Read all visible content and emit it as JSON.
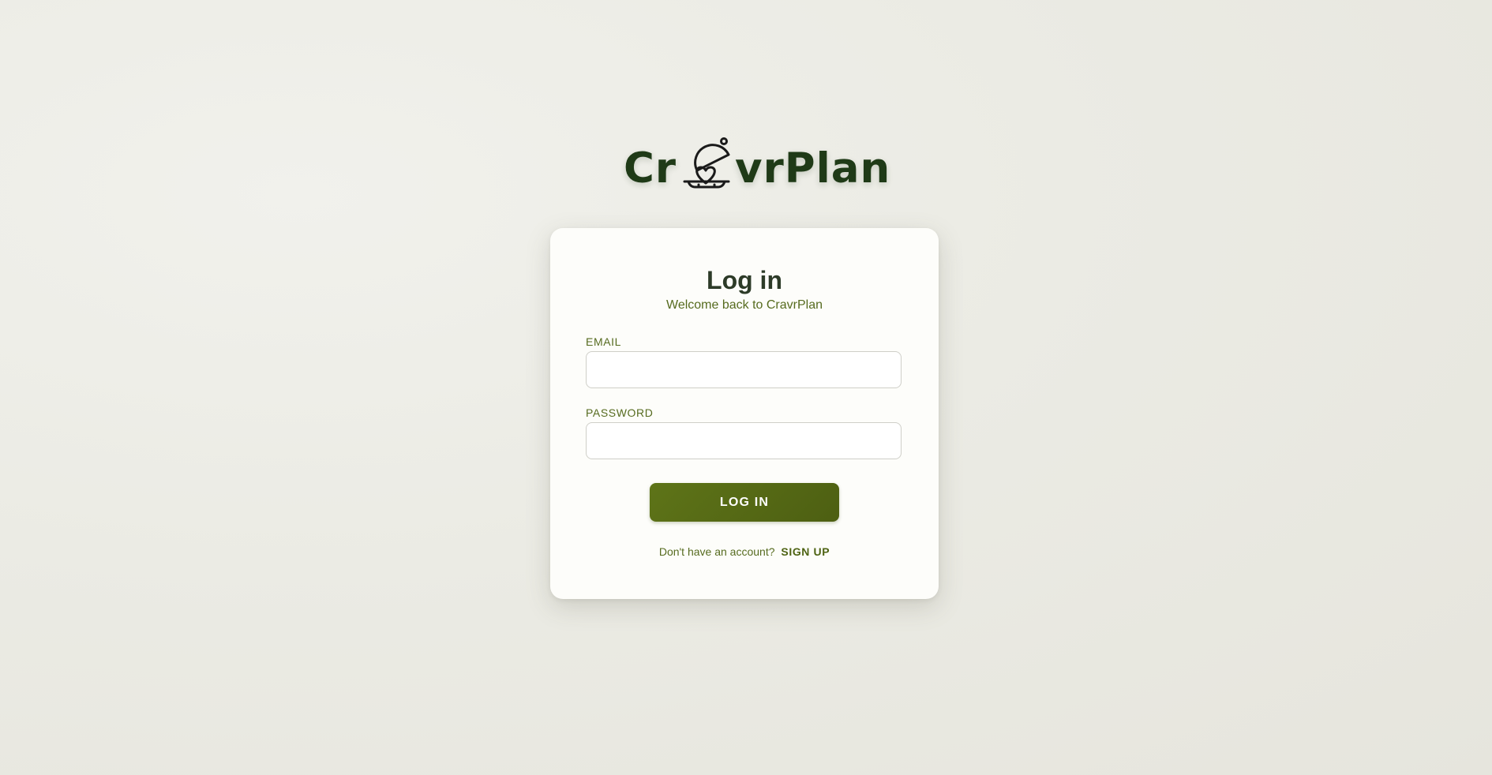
{
  "brand": {
    "logo_prefix": "Cr",
    "logo_suffix": "vrPlan",
    "logo_icon": "cloche-heart-icon",
    "color": "#1f3a17"
  },
  "login_card": {
    "title": "Log in",
    "subtitle": "Welcome back to CravrPlan",
    "email": {
      "label": "EMAIL",
      "value": ""
    },
    "password": {
      "label": "PASSWORD",
      "value": ""
    },
    "submit_label": "LOG IN",
    "signup_prompt": "Don't have an account?",
    "signup_link": "SIGN UP"
  },
  "colors": {
    "accent": "#566b1f",
    "button": "#5a6f17",
    "title": "#2d3b28",
    "card": "#fdfdfa",
    "background": "#ebebe4"
  }
}
